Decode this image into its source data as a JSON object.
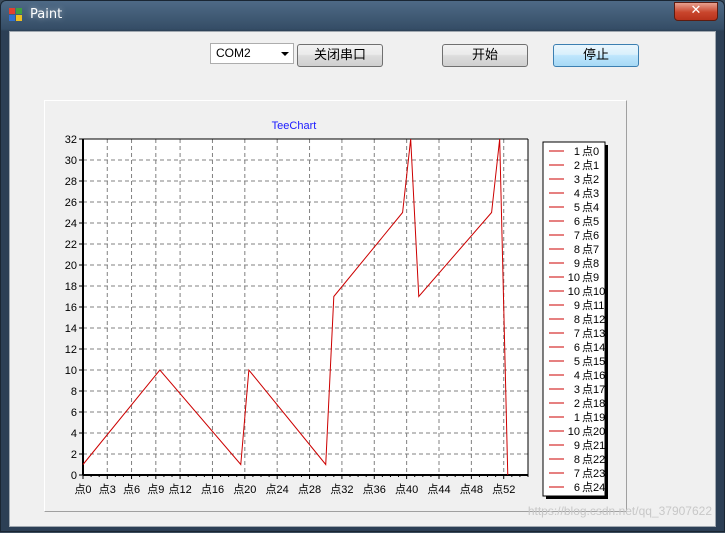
{
  "window": {
    "title": "Paint",
    "close_glyph": "✕"
  },
  "toolbar": {
    "port_select": {
      "selected": "COM2"
    },
    "close_port_label": "关闭串口",
    "start_label": "开始",
    "stop_label": "停止"
  },
  "watermark": "https://blog.csdn.net/qq_37907622",
  "chart_data": {
    "type": "line",
    "title": "TeeChart",
    "ylim": [
      0,
      32
    ],
    "y_ticks": [
      0,
      2,
      4,
      6,
      8,
      10,
      12,
      14,
      16,
      18,
      20,
      22,
      24,
      26,
      28,
      30,
      32
    ],
    "x_tick_labels": [
      "点0",
      "点3",
      "点6",
      "点9",
      "点12",
      "点16",
      "点20",
      "点24",
      "点28",
      "点32",
      "点36",
      "点40",
      "点44",
      "点48",
      "点52"
    ],
    "x_tick_indices": [
      0,
      3,
      6,
      9,
      12,
      16,
      20,
      24,
      28,
      32,
      36,
      40,
      44,
      48,
      52
    ],
    "grid": true,
    "series_color": "#cc0000",
    "legend_position": "right",
    "x": [
      "点0",
      "点1",
      "点2",
      "点3",
      "点4",
      "点5",
      "点6",
      "点7",
      "点8",
      "点9",
      "点10",
      "点11",
      "点12",
      "点13",
      "点14",
      "点15",
      "点16",
      "点17",
      "点18",
      "点19",
      "点20",
      "点21",
      "点22",
      "点23",
      "点24"
    ],
    "values": [
      1,
      2,
      3,
      4,
      5,
      6,
      7,
      8,
      9,
      10,
      10,
      9,
      8,
      7,
      6,
      5,
      4,
      3,
      2,
      1,
      10,
      9,
      8,
      7,
      6
    ],
    "series": [
      {
        "x": [
          0,
          9.5,
          19.5,
          20.5,
          30,
          31,
          39.5,
          40.5,
          41.5,
          50.5,
          51.5,
          52.5
        ],
        "values": [
          1,
          10,
          1,
          10,
          1,
          17,
          25,
          32,
          17,
          25,
          32,
          0
        ]
      }
    ]
  }
}
